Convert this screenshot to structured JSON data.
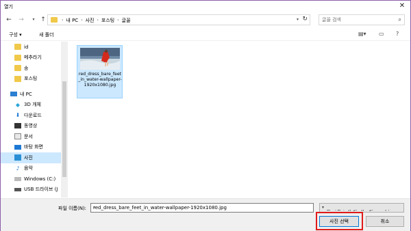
{
  "window": {
    "title": "열기",
    "close_glyph": "✕"
  },
  "address_bar": {
    "crumbs": [
      "내 PC",
      "사진",
      "포스팅",
      "글꼴"
    ]
  },
  "search": {
    "placeholder": "글꼴 검색"
  },
  "toolbar": {
    "organize_label": "구성 ▾",
    "new_folder_label": "새 폴더"
  },
  "nav_pane": {
    "folders": [
      "id",
      "메추라기",
      "송",
      "포스팅"
    ],
    "this_pc": "내 PC",
    "libraries": [
      "3D 개체",
      "다운로드",
      "동영상",
      "문서",
      "바탕 화면",
      "사진",
      "음악"
    ],
    "drives": [
      "Windows (C:)",
      "USB 드라이브 (J"
    ]
  },
  "files": [
    {
      "name": "red_dress_bare_feet_in_water-wallpaper-1920x1080.jpg",
      "selected": true
    }
  ],
  "bottom": {
    "filename_label": "파일 이름(N):",
    "filename_value": "red_dress_bare_feet_in_water-wallpaper-1920x1080.jpg",
    "filetype_value": "모든 파일 (*.jpg;*.jpeg;*.bmp;*.",
    "open_button": "사진 선택",
    "cancel_button": "취소"
  },
  "colors": {
    "selection": "#cce8ff",
    "highlight_box": "#e01a1a",
    "window_border": "#8a5fa8"
  }
}
